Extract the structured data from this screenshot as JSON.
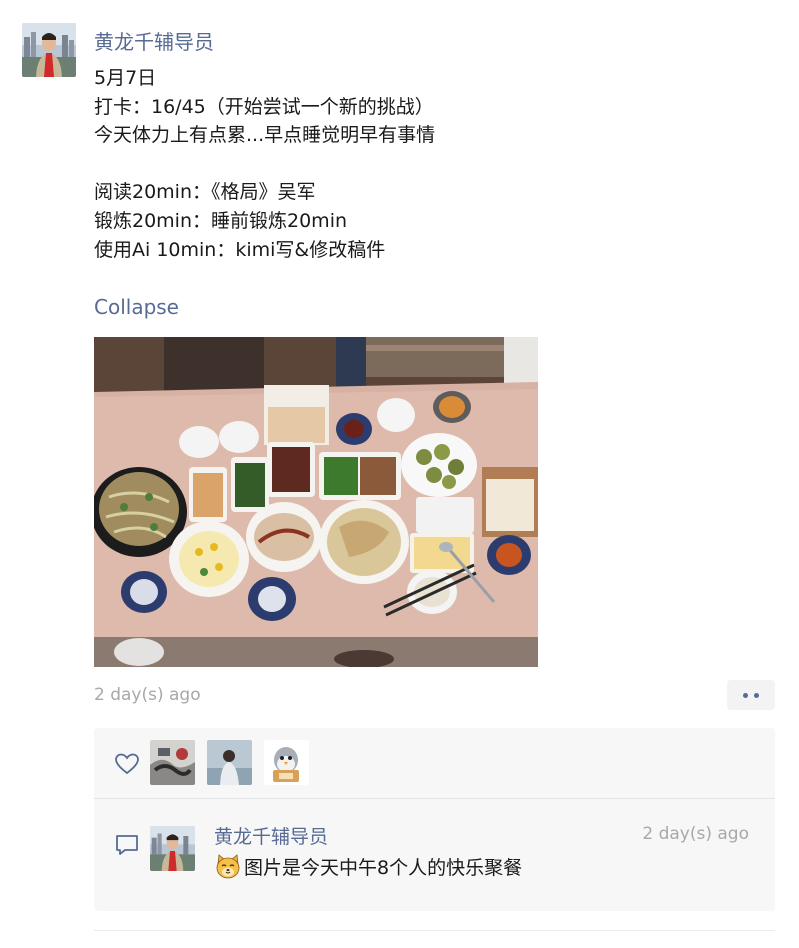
{
  "post": {
    "author": "黄龙千辅导员",
    "lines": [
      "5月7日",
      "打卡：16/45（开始尝试一个新的挑战）",
      "今天体力上有点累...早点睡觉明早有事情",
      "",
      "阅读20min：《格局》吴军",
      "锻炼20min：睡前锻炼20min",
      "使用Ai 10min：kimi写&修改稿件"
    ],
    "collapse_label": "Collapse",
    "timestamp": "2 day(s) ago"
  },
  "likes": {
    "icon": "heart-icon",
    "avatars": [
      "liker-avatar-1",
      "liker-avatar-2",
      "liker-avatar-3"
    ]
  },
  "comments": [
    {
      "author": "黄龙千辅导员",
      "time": "2 day(s) ago",
      "emoji": "cat-face-icon",
      "text": "图片是今天中午8个人的快乐聚餐"
    }
  ],
  "colors": {
    "link": "#576b95",
    "meta": "#a8a8a8",
    "panel": "#f7f7f7"
  }
}
